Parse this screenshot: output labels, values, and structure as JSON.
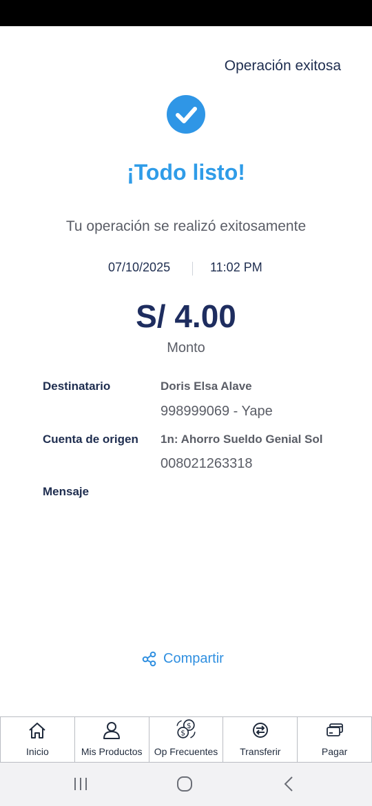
{
  "header": {
    "title": "Operación exitosa"
  },
  "result": {
    "headline": "¡Todo listo!",
    "subtitle": "Tu operación se realizó exitosamente",
    "date": "07/10/2025",
    "time": "11:02 PM",
    "amount": "S/ 4.00",
    "amount_label": "Monto"
  },
  "details": {
    "recipient_label": "Destinatario",
    "recipient_name": "Doris Elsa Alave",
    "recipient_phone": "998999069 - Yape",
    "origin_label": "Cuenta de origen",
    "origin_account_name": "1n: Ahorro Sueldo Genial Sol",
    "origin_account_number": "008021263318",
    "message_label": "Mensaje"
  },
  "share": {
    "label": "Compartir",
    "icon": "share-icon"
  },
  "bottom_nav": {
    "items": [
      {
        "label": "Inicio",
        "icon": "home-icon"
      },
      {
        "label": "Mis Productos",
        "icon": "user-icon"
      },
      {
        "label": "Op Frecuentes",
        "icon": "coins-exchange-icon"
      },
      {
        "label": "Transferir",
        "icon": "transfer-icon"
      },
      {
        "label": "Pagar",
        "icon": "payment-card-icon"
      }
    ]
  },
  "system_nav": {
    "icons": [
      "recent-apps-icon",
      "home-circle-icon",
      "back-icon"
    ]
  },
  "colors": {
    "accent": "#2f9ce8",
    "primary_text": "#1e2d4f",
    "secondary_text": "#5a5d66",
    "check_circle": "#2f96e6"
  }
}
